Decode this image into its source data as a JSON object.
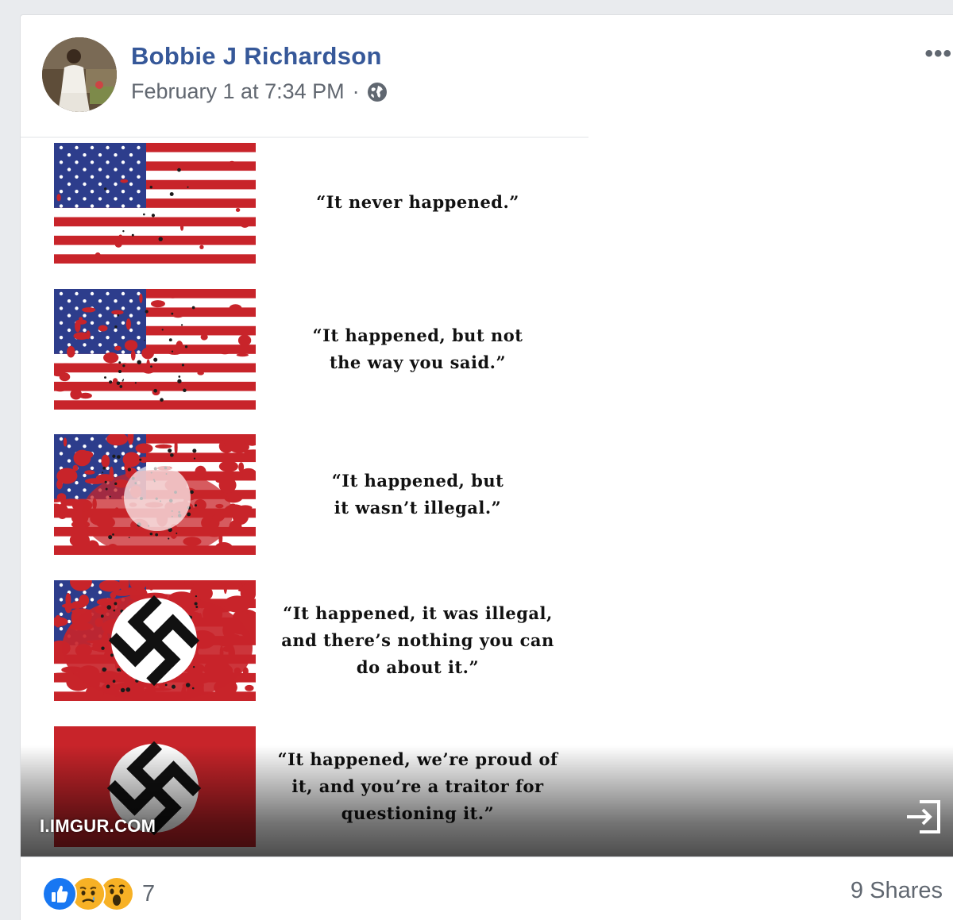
{
  "post": {
    "author": "Bobbie J Richardson",
    "timestamp": "February 1 at 7:34 PM",
    "separator": "·",
    "privacy_icon": "globe-icon",
    "more_icon": "more-options-icon",
    "more_label": "•••"
  },
  "image": {
    "panels": [
      {
        "caption": "“It never happened.”",
        "stage": 0
      },
      {
        "caption": "“It happened, but not\nthe way you said.”",
        "stage": 1
      },
      {
        "caption": "“It happened, but\nit wasn’t illegal.”",
        "stage": 2
      },
      {
        "caption": "“It happened, it was illegal,\nand there’s nothing you can\ndo about it.”",
        "stage": 3
      },
      {
        "caption": "“It happened, we’re proud of\nit, and you’re a traitor for\nquestioning it.”",
        "stage": 4
      }
    ],
    "source": "I.IMGUR.COM",
    "open_icon": "open-link-icon"
  },
  "footer": {
    "reaction_icons": [
      "like-icon",
      "sad-icon",
      "wow-icon"
    ],
    "reaction_count": "7",
    "shares": "9 Shares"
  },
  "colors": {
    "name_blue": "#365899",
    "flag_red": "#c8242a",
    "canton_blue": "#2d3d8c",
    "meta_gray": "#616770"
  }
}
